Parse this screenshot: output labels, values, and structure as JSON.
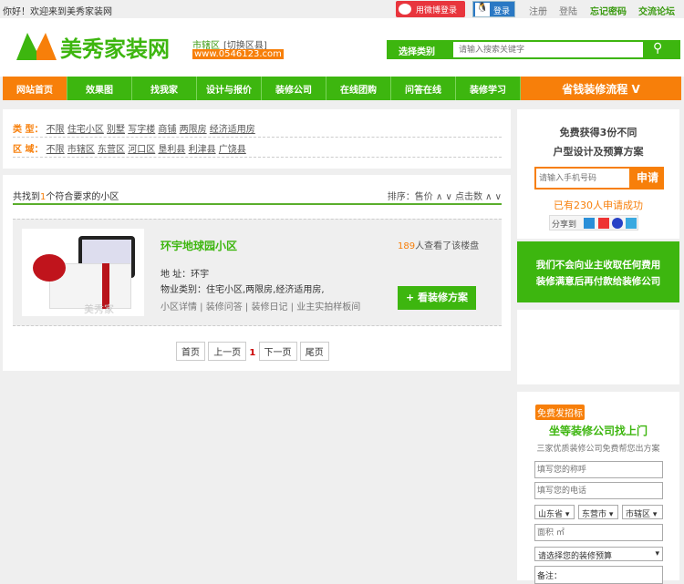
{
  "topbar": {
    "welcome": "你好！欢迎来到美秀家装网",
    "weibo_login": "用微博登录",
    "qq_login": "登录",
    "register": "注册",
    "login": "登陆",
    "forgot": "忘记密码",
    "forum": "交流论坛"
  },
  "header": {
    "logo_text": "美秀家装网",
    "region": "市辖区",
    "switch": "[切换区县]",
    "url": "www.0546123.com",
    "category_label": "选择类别",
    "search_placeholder": "请输入搜索关键字"
  },
  "nav": [
    "网站首页",
    "效果图",
    "找我家",
    "设计与报价",
    "装修公司",
    "在线团购",
    "问答在线",
    "装修学习"
  ],
  "nav_big": "省钱装修流程 V",
  "filters": {
    "type_label": "类  型：",
    "types": [
      "不限",
      "住宅小区",
      "别墅",
      "写字楼",
      "商铺",
      "两限房",
      "经济适用房"
    ],
    "area_label": "区  域：",
    "areas": [
      "不限",
      "市辖区",
      "东营区",
      "河口区",
      "垦利县",
      "利津县",
      "广饶县"
    ]
  },
  "results": {
    "prefix": "共找到",
    "count": "1",
    "suffix": "个符合要求的小区",
    "sort_label": "排序：",
    "sort_price": "售价",
    "sort_clicks": "点击数",
    "up": "∧",
    "down": "∨"
  },
  "listing": {
    "name": "环宇地球园小区",
    "views": "189",
    "views_suffix": "人查看了该楼盘",
    "address": "地  址：环宇",
    "type": "物业类别：住宅小区,两限房,经济适用房,",
    "links": [
      "小区详情",
      "装修问答",
      "装修日记",
      "业主实拍样板间"
    ],
    "cta": "+ 看装修方案",
    "img_watermark": "美秀家"
  },
  "pager": {
    "first": "首页",
    "prev": "上一页",
    "current": "1",
    "next": "下一页",
    "last": "尾页"
  },
  "side1": {
    "line1": "免费获得3份不同",
    "line2": "户型设计及预算方案",
    "phone_placeholder": "请输入手机号码",
    "apply": "申请",
    "count_prefix": "已有",
    "count": "230",
    "count_suffix": "人申请成功",
    "share": "分享到"
  },
  "side2": {
    "line1": "我们不会向业主收取任何费用",
    "line2": "装修满意后再付款给装修公司"
  },
  "side3": {
    "badge": "免费发招标",
    "title": "坐等装修公司找上门",
    "subtitle": "三家优质装修公司免费帮您出方案",
    "name_ph": "填写您的称呼",
    "phone_ph": "填写您的电话",
    "province": "山东省",
    "city": "东营市",
    "district": "市辖区",
    "area_ph": "面积 ㎡",
    "budget": "请选择您的装修预算",
    "note": "备注："
  }
}
